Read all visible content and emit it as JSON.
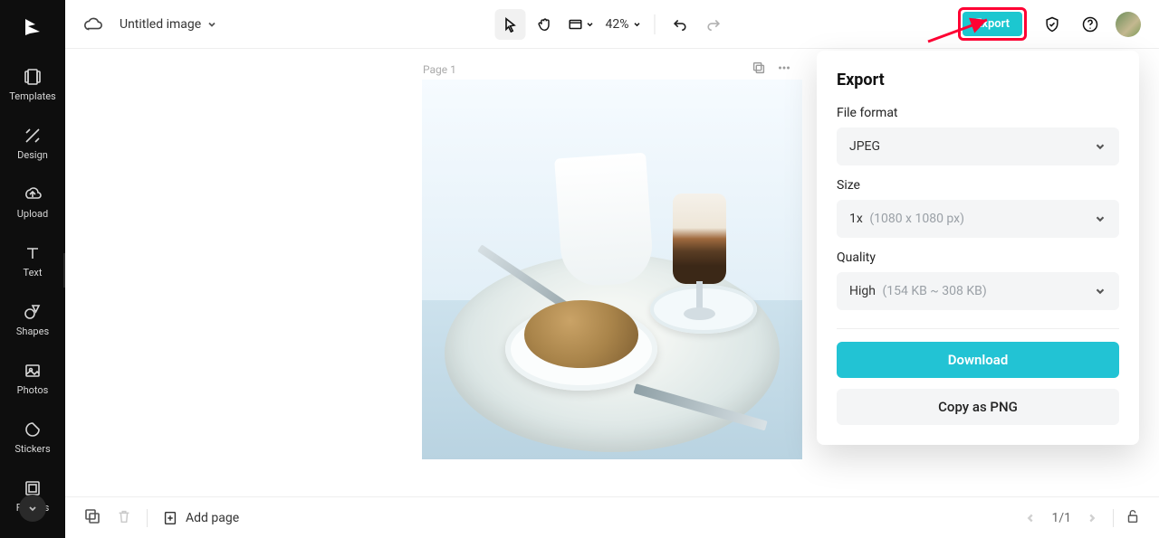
{
  "document": {
    "title": "Untitled image"
  },
  "sidebar": {
    "items": [
      {
        "label": "Templates"
      },
      {
        "label": "Design"
      },
      {
        "label": "Upload"
      },
      {
        "label": "Text"
      },
      {
        "label": "Shapes"
      },
      {
        "label": "Photos"
      },
      {
        "label": "Stickers"
      },
      {
        "label": "Frames"
      }
    ]
  },
  "toolbar": {
    "zoom": "42%"
  },
  "canvas": {
    "page_label": "Page 1"
  },
  "export": {
    "button_label": "Export",
    "title": "Export",
    "file_format_label": "File format",
    "file_format_value": "JPEG",
    "size_label": "Size",
    "size_value": "1x",
    "size_hint": "(1080 x 1080 px)",
    "quality_label": "Quality",
    "quality_value": "High",
    "quality_hint": "(154 KB ~ 308 KB)",
    "download_label": "Download",
    "copy_label": "Copy as PNG"
  },
  "bottombar": {
    "add_page_label": "Add page",
    "page_indicator": "1/1"
  }
}
